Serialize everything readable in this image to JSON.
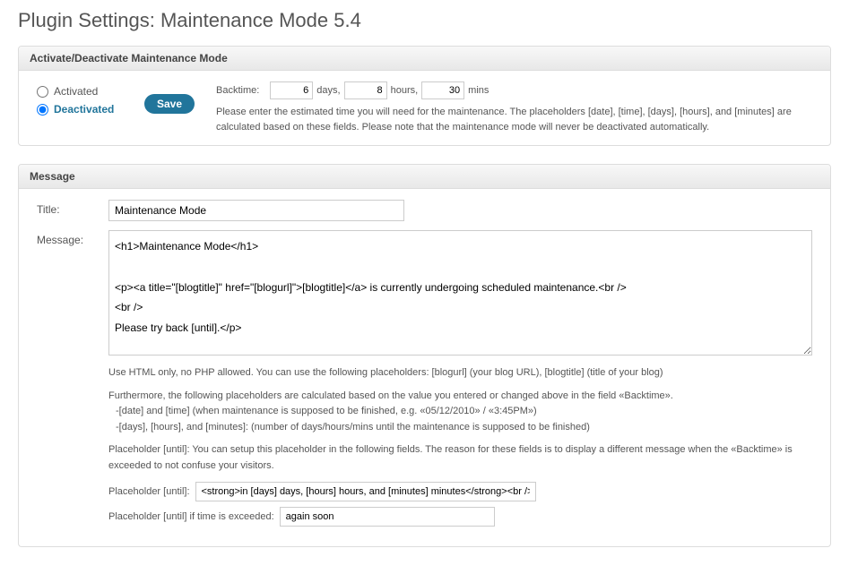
{
  "page": {
    "title": "Plugin Settings: Maintenance Mode 5.4"
  },
  "panel1": {
    "header": "Activate/Deactivate Maintenance Mode",
    "radio_activated": "Activated",
    "radio_deactivated": "Deactivated",
    "save": "Save",
    "backtime_label": "Backtime:",
    "days_val": "6",
    "days_unit": "days,",
    "hours_val": "8",
    "hours_unit": "hours,",
    "mins_val": "30",
    "mins_unit": "mins",
    "hint": "Please enter the estimated time you will need for the maintenance. The placeholders [date], [time], [days], [hours], and [minutes] are calculated based on these fields. Please note that the maintenance mode will never be deactivated automatically."
  },
  "panel2": {
    "header": "Message",
    "title_label": "Title:",
    "title_value": "Maintenance Mode",
    "message_label": "Message:",
    "message_value": "<h1>Maintenance Mode</h1>\n\n<p><a title=\"[blogtitle]\" href=\"[blogurl]\">[blogtitle]</a> is currently undergoing scheduled maintenance.<br />\n<br />\nPlease try back [until].</p>\n\n<p>Sorry for the inconvenience.</p>",
    "help1": "Use HTML only, no PHP allowed. You can use the following placeholders: [blogurl] (your blog URL), [blogtitle] (title of your blog)",
    "help2": "Furthermore, the following placeholders are calculated based on the value you entered or changed above in the field «Backtime».",
    "help2a": "-[date] and [time] (when maintenance is supposed to be finished, e.g. «05/12/2010» / «3:45PM»)",
    "help2b": "-[days], [hours], and [minutes]: (number of days/hours/mins until the maintenance is supposed to be finished)",
    "help3": "Placeholder [until]: You can setup this placeholder in the following fields. The reason for these fields is to display a different message when the «Backtime» is exceeded to not confuse your visitors.",
    "ph_until_label": "Placeholder [until]:",
    "ph_until_value": "<strong>in [days] days, [hours] hours, and [minutes] minutes</strong><br />(c",
    "ph_exceeded_label": "Placeholder [until] if time is exceeded:",
    "ph_exceeded_value": "again soon"
  }
}
